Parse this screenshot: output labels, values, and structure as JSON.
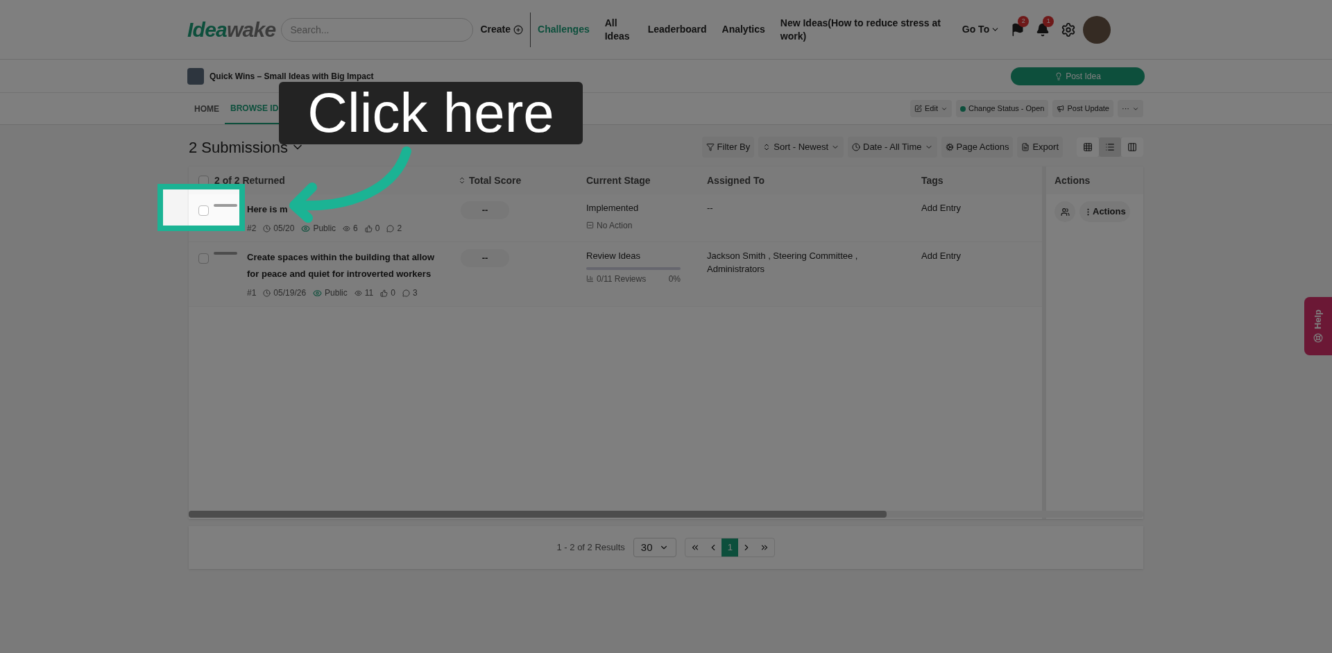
{
  "header": {
    "logo": {
      "part_1": "Idea",
      "part_2": "wake"
    },
    "search": {
      "placeholder": "Search..."
    },
    "create": "Create",
    "nav": [
      {
        "label": "Challenges",
        "selected": true
      },
      {
        "label": "All Ideas",
        "selected": false
      },
      {
        "label": "Leaderboard",
        "selected": false
      },
      {
        "label": "Analytics",
        "selected": false
      },
      {
        "label": "New Ideas(How to reduce stress at work)",
        "selected": false
      }
    ],
    "goto": "Go To",
    "flag_badge": "2",
    "bell_badge": "1"
  },
  "challenge": {
    "title": "Quick Wins – Small Ideas with Big Impact",
    "post_button": "Post Idea"
  },
  "tabs": [
    {
      "label": "HOME",
      "selected": false
    },
    {
      "label": "BROWSE ID",
      "selected": true
    }
  ],
  "tab_actions": {
    "edit": "Edit",
    "status": "Change Status - Open",
    "post_update": "Post Update",
    "more": "···"
  },
  "submissions": {
    "title": "2 Submissions",
    "tools": [
      "Filter By",
      "Sort - Newest",
      "Date - All Time",
      "Page Actions",
      "Export"
    ],
    "views": [
      {
        "kind": "grid",
        "selected": false
      },
      {
        "kind": "list",
        "selected": true
      },
      {
        "kind": "columns",
        "selected": false
      }
    ]
  },
  "table": {
    "select_all_checked": false,
    "columns": [
      "2 of 2 Returned",
      "Total Score",
      "Current Stage",
      "Assigned To",
      "Tags",
      "Actions"
    ],
    "rows": [
      {
        "checked": false,
        "title": "Here is m",
        "id": "#2",
        "date": "05/20",
        "visibility": "Public",
        "views": "6",
        "likes": "0",
        "comments": "2",
        "score": "--",
        "stage": "Implemented",
        "stage_note": "No Action",
        "assigned": "--",
        "tags": "Add Entry",
        "actions": "Actions"
      },
      {
        "checked": false,
        "title": "Create spaces within the building that allow for peace and quiet for introverted workers",
        "id": "#1",
        "date": "05/19/26",
        "visibility": "Public",
        "views": "11",
        "likes": "0",
        "comments": "3",
        "score": "--",
        "stage": "Review Ideas",
        "stage_note": "0/11 Reviews",
        "percent": "0%",
        "level": 0,
        "assigned": "Jackson Smith , Steering Committee , Administrators",
        "tags": "Add Entry"
      }
    ]
  },
  "pagination": {
    "summary": "1 - 2 of 2 Results",
    "per_page": "30",
    "pages": [
      {
        "label": "1",
        "selected": true
      }
    ]
  },
  "help": "Help",
  "tutorial": {
    "tooltip": "Click here"
  }
}
